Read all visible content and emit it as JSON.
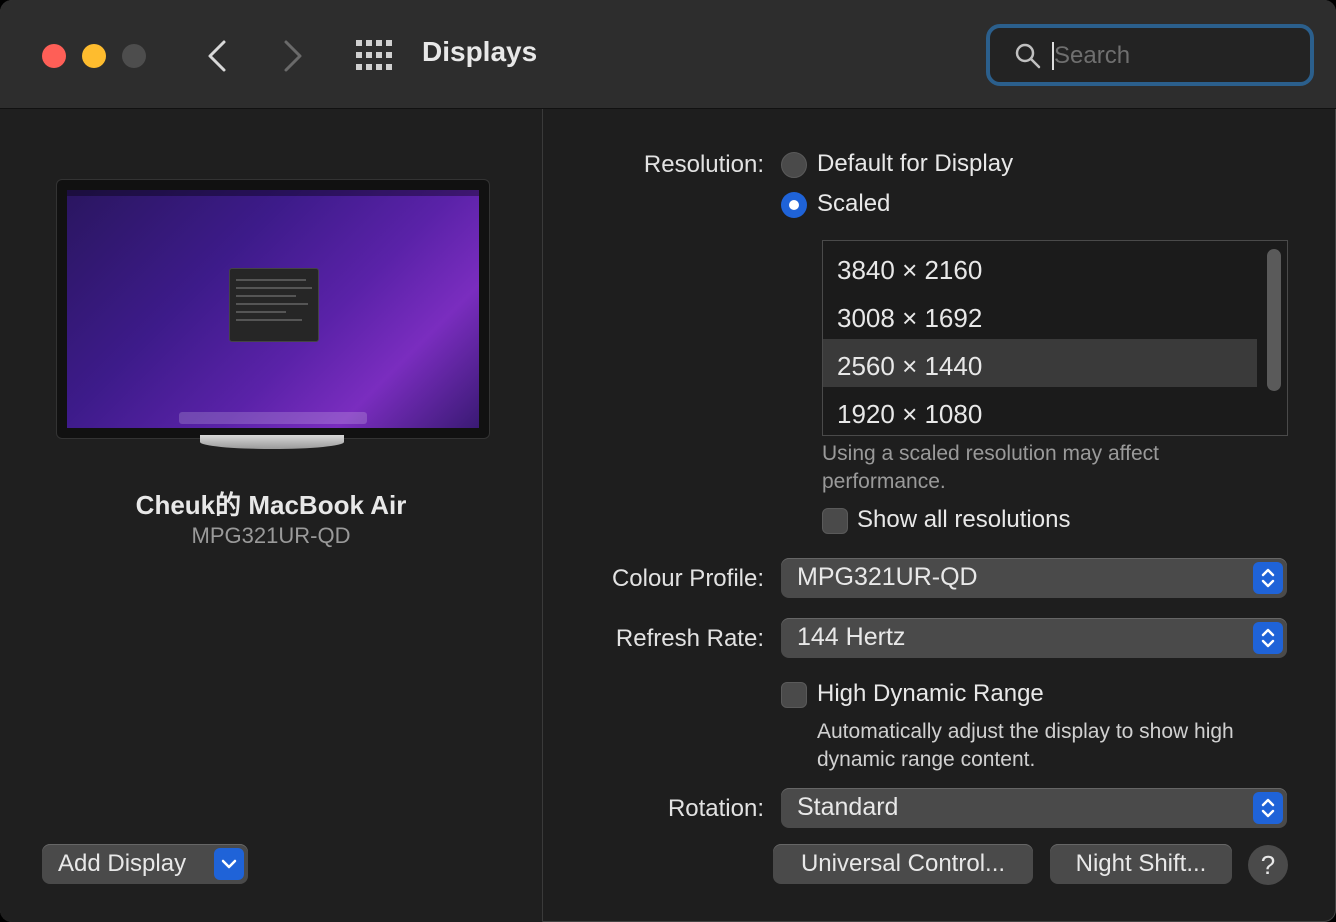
{
  "window": {
    "title": "Displays"
  },
  "search": {
    "placeholder": "Search"
  },
  "display": {
    "computer_name": "Cheuk的 MacBook Air",
    "model": "MPG321UR-QD",
    "add_display_label": "Add Display"
  },
  "resolution": {
    "label": "Resolution:",
    "option_default": "Default for Display",
    "option_scaled": "Scaled",
    "selected_option": "Scaled",
    "items": [
      "3840 × 2160",
      "3008 × 1692",
      "2560 × 1440",
      "1920 × 1080"
    ],
    "selected_item": "2560 × 1440",
    "note": "Using a scaled resolution may affect performance.",
    "show_all_label": "Show all resolutions",
    "show_all_checked": false
  },
  "colour_profile": {
    "label": "Colour Profile:",
    "value": "MPG321UR-QD"
  },
  "refresh_rate": {
    "label": "Refresh Rate:",
    "value": "144 Hertz"
  },
  "hdr": {
    "label": "High Dynamic Range",
    "checked": false,
    "description": "Automatically adjust the display to show high dynamic range content."
  },
  "rotation": {
    "label": "Rotation:",
    "value": "Standard"
  },
  "buttons": {
    "universal_control": "Universal Control...",
    "night_shift": "Night Shift...",
    "help": "?"
  },
  "colors": {
    "accent": "#1f63d8",
    "search_focus": "#2b5f8c",
    "close": "#fe5f57",
    "minimize": "#febc2e"
  }
}
